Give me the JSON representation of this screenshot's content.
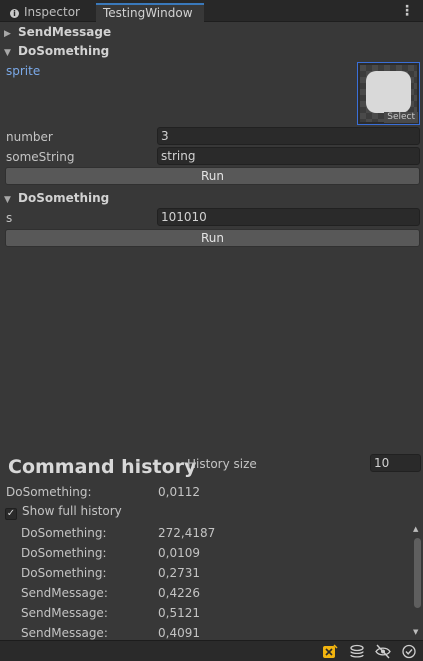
{
  "tabs": [
    {
      "label": "Inspector",
      "icon": "info-icon"
    },
    {
      "label": "TestingWindow",
      "active": true
    }
  ],
  "sections": {
    "send_message": {
      "title": "SendMessage",
      "expanded": false
    },
    "do_something_1": {
      "title": "DoSomething",
      "expanded": true,
      "sprite_label": "sprite",
      "sprite_select": "Select",
      "fields": [
        {
          "label": "number",
          "value": "3"
        },
        {
          "label": "someString",
          "value": "string"
        }
      ],
      "run_label": "Run"
    },
    "do_something_2": {
      "title": "DoSomething",
      "expanded": true,
      "fields": [
        {
          "label": "s",
          "value": "101010"
        }
      ],
      "run_label": "Run"
    }
  },
  "command_history": {
    "title": "Command history",
    "history_size_label": "History size",
    "history_size_value": "10",
    "last": {
      "name": "DoSomething:",
      "value": "0,0112"
    },
    "show_full_history_label": "Show full history",
    "show_full_history_checked": true,
    "items": [
      {
        "name": "DoSomething:",
        "value": "272,4187"
      },
      {
        "name": "DoSomething:",
        "value": "0,0109"
      },
      {
        "name": "DoSomething:",
        "value": "0,2731"
      },
      {
        "name": "SendMessage:",
        "value": "0,4226"
      },
      {
        "name": "SendMessage:",
        "value": "0,5121"
      },
      {
        "name": "SendMessage:",
        "value": "0,4091"
      }
    ]
  },
  "status_icons": [
    "debug-bug-icon",
    "layers-stack-icon",
    "hidden-eye-icon",
    "check-circle-icon"
  ],
  "colors": {
    "accent": "#3a79bb",
    "sprite_link": "#7ba9e8",
    "panel_bg": "#383838"
  }
}
